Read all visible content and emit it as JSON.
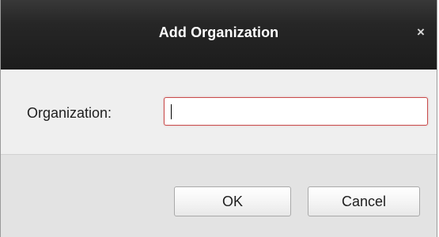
{
  "dialog": {
    "title": "Add Organization",
    "close_symbol": "×"
  },
  "form": {
    "organization_label": "Organization:",
    "organization_value": ""
  },
  "buttons": {
    "ok_label": "OK",
    "cancel_label": "Cancel"
  },
  "colors": {
    "titlebar": "#262626",
    "title_text": "#ffffff",
    "input_focus_border": "#c94d4d",
    "body_background": "#efefef",
    "footer_background": "#e3e3e3"
  }
}
